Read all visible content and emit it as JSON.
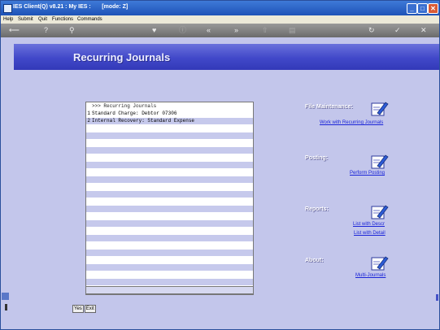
{
  "window": {
    "title": "IES Client(Q) v8.21 : My IES :       [mode: Z]"
  },
  "menu": {
    "items": [
      "Help",
      "Submit",
      "Quit",
      "Functions",
      "Commands"
    ]
  },
  "page": {
    "title": "Recurring Journals"
  },
  "grid": {
    "header_text": ">>> Recurring Journals",
    "rows": [
      {
        "num": "1",
        "text": "Standard Charge: Debtor 07306"
      },
      {
        "num": "2",
        "text": "Internal Recovery: Standard Expense"
      }
    ]
  },
  "bottom_buttons": [
    "Yes",
    "Exit"
  ],
  "sections": {
    "file_maintenance": {
      "label": "File Maintenance:",
      "links": [
        "Work with Recurring Journals"
      ]
    },
    "posting": {
      "label": "Posting:",
      "links": [
        "Perform Posting"
      ]
    },
    "reports": {
      "label": "Reports:",
      "links": [
        "List with Descr",
        "List with Detail"
      ]
    },
    "about": {
      "label": "About:",
      "links": [
        "Multi-Journals"
      ]
    }
  },
  "icons": [
    "pencil-doc-icon"
  ],
  "colors": {
    "background": "#c3c6eb",
    "header_band": "#4148c9",
    "link": "#1a24d8"
  }
}
